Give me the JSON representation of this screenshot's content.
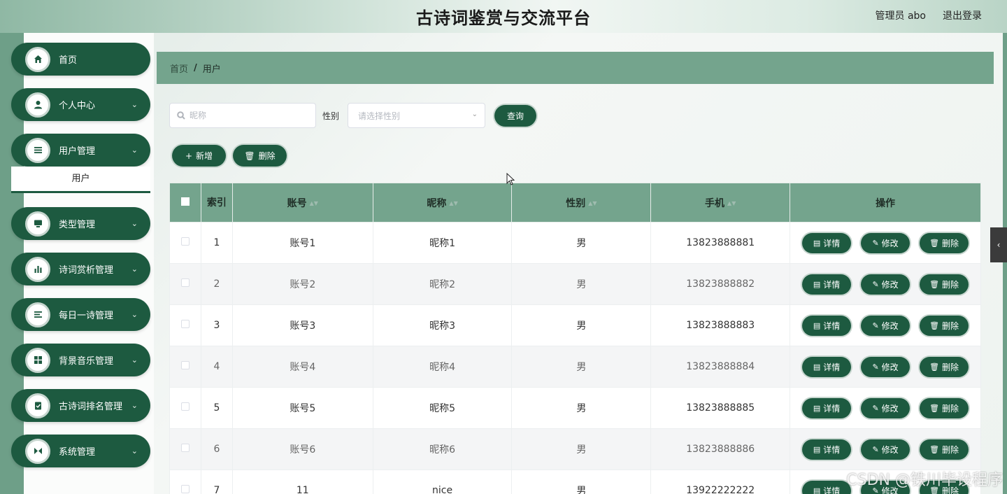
{
  "header": {
    "title": "古诗词鉴赏与交流平台",
    "user_info": "管理员 abo",
    "logout": "退出登录"
  },
  "sidebar": {
    "items": [
      {
        "label": "首页",
        "icon": "home-icon",
        "has_children": false
      },
      {
        "label": "个人中心",
        "icon": "user-icon",
        "has_children": true
      },
      {
        "label": "用户管理",
        "icon": "list-icon",
        "has_children": true
      },
      {
        "label": "类型管理",
        "icon": "monitor-icon",
        "has_children": true
      },
      {
        "label": "诗词赏析管理",
        "icon": "chart-icon",
        "has_children": true
      },
      {
        "label": "每日一诗管理",
        "icon": "doc-icon",
        "has_children": true
      },
      {
        "label": "背景音乐管理",
        "icon": "grid-icon",
        "has_children": true
      },
      {
        "label": "古诗词排名管理",
        "icon": "clipboard-icon",
        "has_children": true
      },
      {
        "label": "系统管理",
        "icon": "settings-icon",
        "has_children": true
      }
    ],
    "submenu": {
      "label": "用户"
    }
  },
  "breadcrumb": {
    "home": "首页",
    "separator": "/",
    "current": "用户"
  },
  "filters": {
    "search_placeholder": "昵称",
    "gender_label": "性别",
    "gender_placeholder": "请选择性别",
    "query_button": "查询"
  },
  "toolbar": {
    "add_label": "新增",
    "delete_label": "删除"
  },
  "table": {
    "columns": [
      "索引",
      "账号",
      "昵称",
      "性别",
      "手机",
      "操作"
    ],
    "rows": [
      {
        "index": "1",
        "account": "账号1",
        "nickname": "昵称1",
        "gender": "男",
        "phone": "13823888881"
      },
      {
        "index": "2",
        "account": "账号2",
        "nickname": "昵称2",
        "gender": "男",
        "phone": "13823888882"
      },
      {
        "index": "3",
        "account": "账号3",
        "nickname": "昵称3",
        "gender": "男",
        "phone": "13823888883"
      },
      {
        "index": "4",
        "account": "账号4",
        "nickname": "昵称4",
        "gender": "男",
        "phone": "13823888884"
      },
      {
        "index": "5",
        "account": "账号5",
        "nickname": "昵称5",
        "gender": "男",
        "phone": "13823888885"
      },
      {
        "index": "6",
        "account": "账号6",
        "nickname": "昵称6",
        "gender": "男",
        "phone": "13823888886"
      },
      {
        "index": "7",
        "account": "11",
        "nickname": "nice",
        "gender": "男",
        "phone": "13922222222"
      }
    ],
    "actions": {
      "detail": "详情",
      "edit": "修改",
      "delete": "删除"
    }
  },
  "watermark": "CSDN @铁川毕设程序",
  "colors": {
    "accent": "#1d5a40",
    "header_row": "#74a48d",
    "sidebar_stripe": "#6e9f88"
  }
}
